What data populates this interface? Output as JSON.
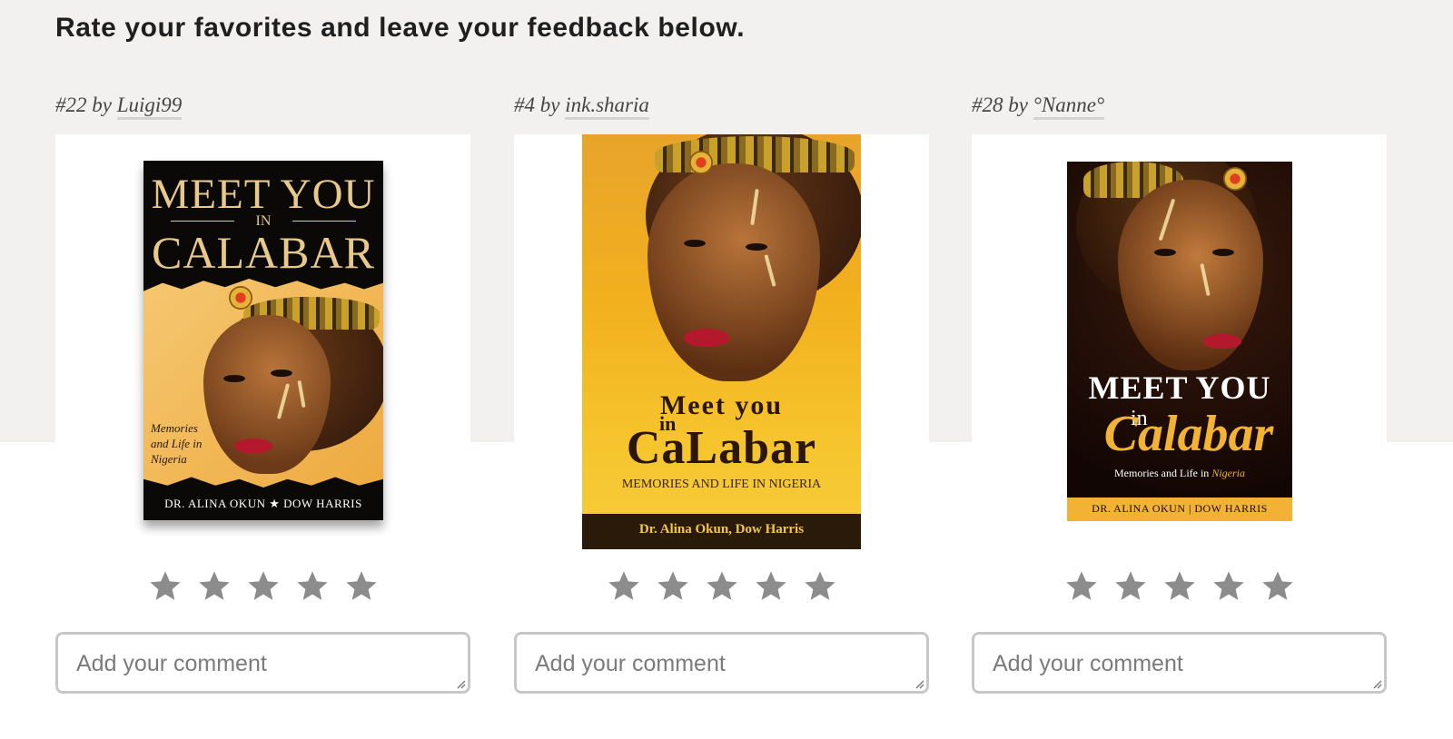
{
  "page": {
    "heading": "Rate your favorites and leave your feedback below.",
    "background_top": "#f2f1f0"
  },
  "entries": [
    {
      "number": "#22",
      "by": "by",
      "author": "Luigi99",
      "cover": {
        "title_line1": "MEET YOU",
        "title_line2": "IN",
        "title_line3": "CALABAR",
        "side_text_1": "Memories",
        "side_text_2": "and Life in",
        "side_text_3": "Nigeria",
        "authors": "DR. ALINA OKUN ★ DOW HARRIS",
        "colors": {
          "background": "#0b0907",
          "title": "#e9c98a",
          "band": "#f0b652"
        }
      },
      "rating": 0,
      "comment_placeholder": "Add your comment"
    },
    {
      "number": "#4",
      "by": "by",
      "author": "ink.sharia",
      "cover": {
        "title_line1": "Meet you",
        "title_line2": "in",
        "title_line3": "CaLabar",
        "subtitle": "MEMORIES AND LIFE IN NIGERIA",
        "authors": "Dr. Alina Okun, Dow Harris",
        "colors": {
          "background": "#f2b01e",
          "title": "#2a160a",
          "band": "#2a1a0a"
        }
      },
      "rating": 0,
      "comment_placeholder": "Add your comment"
    },
    {
      "number": "#28",
      "by": "by",
      "author": "°Nanne°",
      "cover": {
        "title_line1": "MEET YOU",
        "title_line2": "in",
        "title_line3": "Calabar",
        "subtitle_a": "Memories and Life in",
        "subtitle_b": "Nigeria",
        "authors": "DR. ALINA OKUN | DOW HARRIS",
        "colors": {
          "background": "#1a0a06",
          "title": "#ffffff",
          "script": "#f2b234",
          "band": "#f2b234"
        }
      },
      "rating": 0,
      "comment_placeholder": "Add your comment"
    }
  ],
  "star_color": "#8c8c8c",
  "icons": {
    "star": "star-icon",
    "resize": "resize-grip-icon"
  }
}
